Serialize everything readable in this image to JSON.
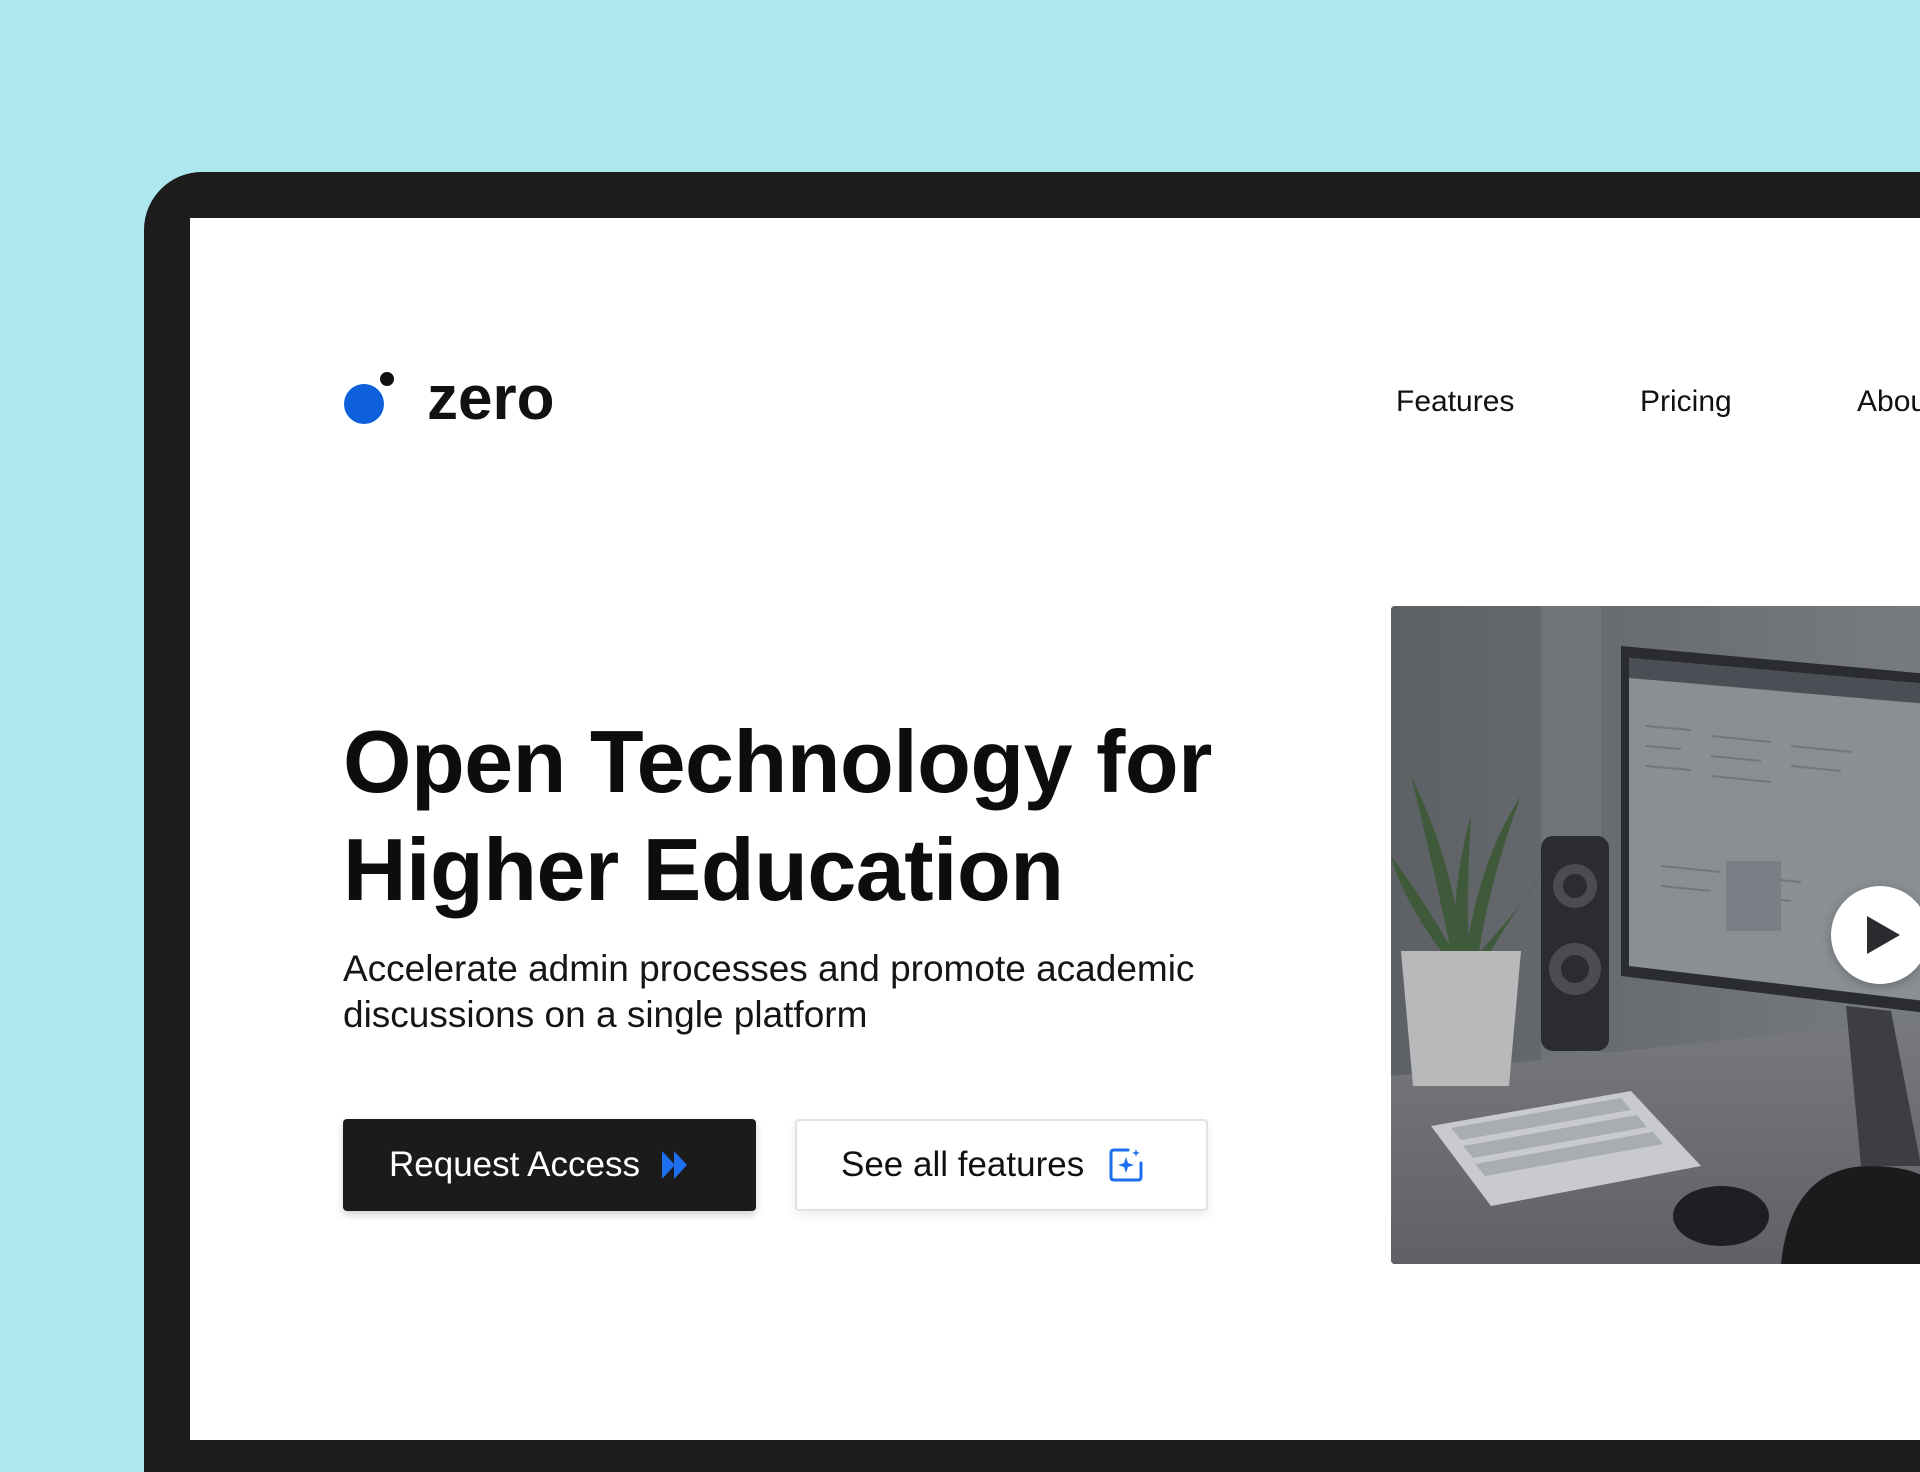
{
  "brand": {
    "name": "zero",
    "color": "#0d5fdc"
  },
  "nav": {
    "items": [
      {
        "label": "Features"
      },
      {
        "label": "Pricing"
      },
      {
        "label": "About"
      }
    ]
  },
  "hero": {
    "title_lines": [
      "Open Technology for",
      "Higher Education"
    ],
    "subtitle_lines": [
      "Accelerate admin processes and promote academic",
      "discussions on a single platform"
    ],
    "primary_button": {
      "label": "Request Access",
      "icon": "double-chevron-right-icon"
    },
    "secondary_button": {
      "label": "See all features",
      "icon": "sparkle-square-icon"
    }
  },
  "media": {
    "description_icon": "play-icon",
    "accent": "#ffffff"
  }
}
